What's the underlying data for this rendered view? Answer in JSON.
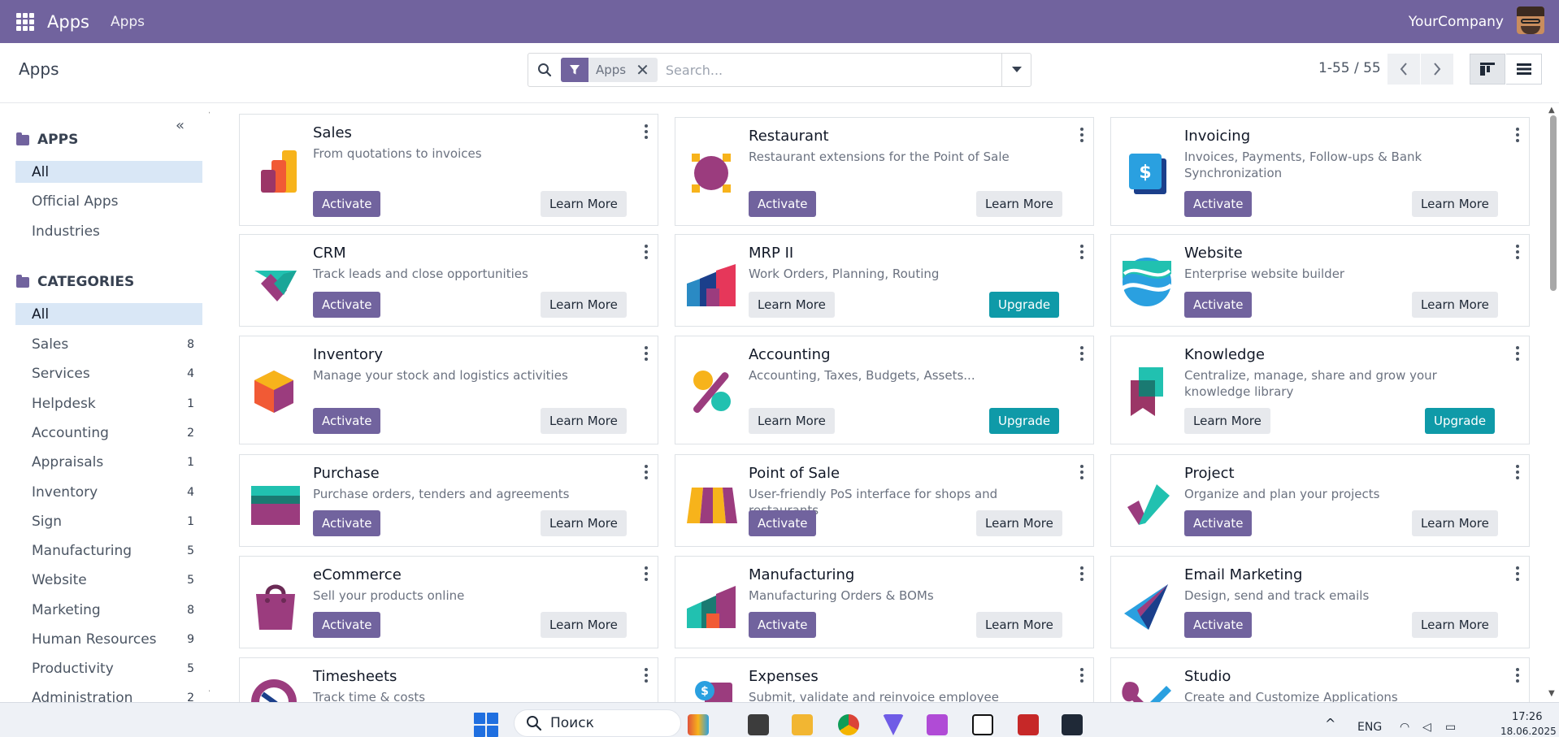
{
  "topbar": {
    "brand": "Apps",
    "menu_item": "Apps",
    "company": "YourCompany"
  },
  "control": {
    "title": "Apps",
    "search": {
      "facet_label": "Apps",
      "placeholder": "Search..."
    },
    "pager": "1-55 / 55"
  },
  "sidebar": {
    "apps_header": "APPS",
    "apps_items": [
      {
        "label": "All",
        "active": true
      },
      {
        "label": "Official Apps"
      },
      {
        "label": "Industries"
      }
    ],
    "categories_header": "CATEGORIES",
    "categories": [
      {
        "label": "All",
        "count": "",
        "active": true
      },
      {
        "label": "Sales",
        "count": "8"
      },
      {
        "label": "Services",
        "count": "4"
      },
      {
        "label": "Helpdesk",
        "count": "1"
      },
      {
        "label": "Accounting",
        "count": "2"
      },
      {
        "label": "Appraisals",
        "count": "1"
      },
      {
        "label": "Inventory",
        "count": "4"
      },
      {
        "label": "Sign",
        "count": "1"
      },
      {
        "label": "Manufacturing",
        "count": "5"
      },
      {
        "label": "Website",
        "count": "5"
      },
      {
        "label": "Marketing",
        "count": "8"
      },
      {
        "label": "Human Resources",
        "count": "9"
      },
      {
        "label": "Productivity",
        "count": "5"
      },
      {
        "label": "Administration",
        "count": "2"
      }
    ]
  },
  "buttons": {
    "activate": "Activate",
    "learn_more": "Learn More",
    "upgrade": "Upgrade"
  },
  "apps": [
    {
      "name": "Sales",
      "desc": "From quotations to invoices",
      "left": "activate",
      "right": "learn_more",
      "icon": "sales-icon"
    },
    {
      "name": "Restaurant",
      "desc": "Restaurant extensions for the Point of Sale",
      "left": "activate",
      "right": "learn_more",
      "icon": "restaurant-icon"
    },
    {
      "name": "Invoicing",
      "desc": "Invoices, Payments, Follow-ups & Bank Synchronization",
      "left": "activate",
      "right": "learn_more",
      "icon": "invoicing-icon"
    },
    {
      "name": "CRM",
      "desc": "Track leads and close opportunities",
      "left": "activate",
      "right": "learn_more",
      "icon": "crm-icon"
    },
    {
      "name": "MRP II",
      "desc": "Work Orders, Planning, Routing",
      "left": "learn_more",
      "right": "upgrade",
      "icon": "mrp-icon"
    },
    {
      "name": "Website",
      "desc": "Enterprise website builder",
      "left": "activate",
      "right": "learn_more",
      "icon": "website-icon"
    },
    {
      "name": "Inventory",
      "desc": "Manage your stock and logistics activities",
      "left": "activate",
      "right": "learn_more",
      "icon": "inventory-icon"
    },
    {
      "name": "Accounting",
      "desc": "Accounting, Taxes, Budgets, Assets...",
      "left": "learn_more",
      "right": "upgrade",
      "icon": "accounting-icon"
    },
    {
      "name": "Knowledge",
      "desc": "Centralize, manage, share and grow your knowledge library",
      "left": "learn_more",
      "right": "upgrade",
      "icon": "knowledge-icon"
    },
    {
      "name": "Purchase",
      "desc": "Purchase orders, tenders and agreements",
      "left": "activate",
      "right": "learn_more",
      "icon": "purchase-icon"
    },
    {
      "name": "Point of Sale",
      "desc": "User-friendly PoS interface for shops and restaurants",
      "left": "activate",
      "right": "learn_more",
      "icon": "point-of-sale-icon"
    },
    {
      "name": "Project",
      "desc": "Organize and plan your projects",
      "left": "activate",
      "right": "learn_more",
      "icon": "project-icon"
    },
    {
      "name": "eCommerce",
      "desc": "Sell your products online",
      "left": "activate",
      "right": "learn_more",
      "icon": "ecommerce-icon"
    },
    {
      "name": "Manufacturing",
      "desc": "Manufacturing Orders & BOMs",
      "left": "activate",
      "right": "learn_more",
      "icon": "manufacturing-icon"
    },
    {
      "name": "Email Marketing",
      "desc": "Design, send and track emails",
      "left": "activate",
      "right": "learn_more",
      "icon": "email-marketing-icon"
    },
    {
      "name": "Timesheets",
      "desc": "Track time & costs",
      "left": "",
      "right": "",
      "icon": "timesheets-icon"
    },
    {
      "name": "Expenses",
      "desc": "Submit, validate and reinvoice employee expenses",
      "left": "",
      "right": "",
      "icon": "expenses-icon"
    },
    {
      "name": "Studio",
      "desc": "Create and Customize Applications",
      "left": "",
      "right": "",
      "icon": "studio-icon"
    }
  ],
  "taskbar": {
    "search_label": "Поиск",
    "lang": "ENG",
    "time": "17:26",
    "date": "18.06.2025"
  },
  "colors": {
    "brand": "#71639e",
    "upgrade": "#0f9aa8",
    "active_bg": "#d9e7f6"
  }
}
